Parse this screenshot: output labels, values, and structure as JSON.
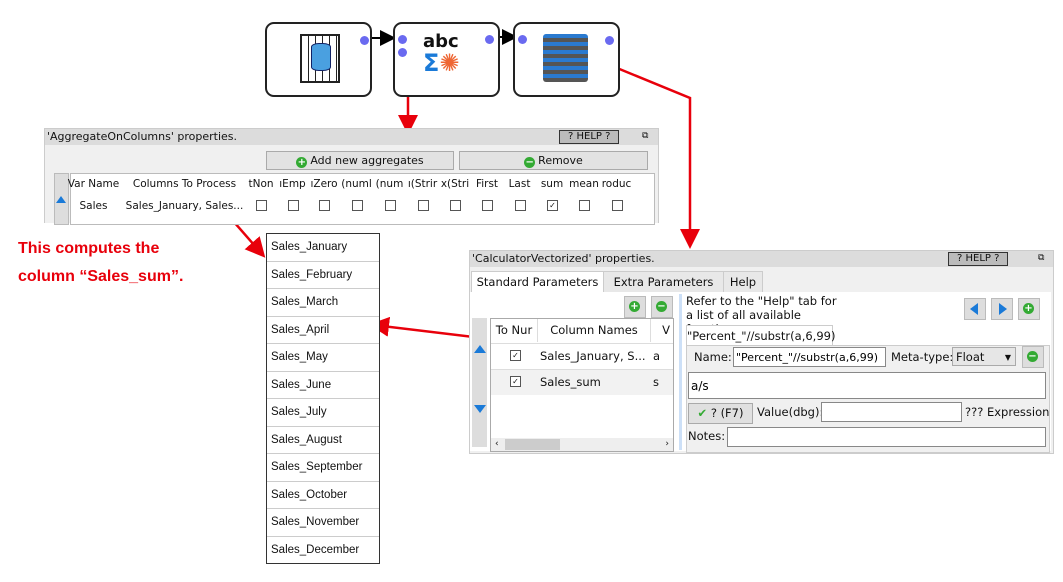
{
  "workflow": {
    "nodes": [
      {
        "name": "data-table-node"
      },
      {
        "name": "aggregate-on-columns-node"
      },
      {
        "name": "calculator-vectorized-node"
      }
    ]
  },
  "aggregate": {
    "title": "'AggregateOnColumns' properties.",
    "help": "? HELP ?",
    "add": "Add new aggregates",
    "remove": "Remove",
    "headers": [
      "Var Name",
      "Columns To Process",
      "tNon",
      "ıEmp",
      "ıZero",
      "(numl",
      "(num",
      "ı(Strir",
      "x(Stri",
      "First",
      "Last",
      "sum",
      "mean",
      "roduc"
    ],
    "row": {
      "var": "Sales",
      "cols": "Sales_January, Sales...",
      "checks": [
        false,
        false,
        false,
        false,
        false,
        false,
        false,
        false,
        false,
        true,
        false,
        false
      ]
    }
  },
  "annotation": {
    "line1": "This computes the",
    "line2": "column “Sales_sum”."
  },
  "months": [
    "Sales_January",
    "Sales_February",
    "Sales_March",
    "Sales_April",
    "Sales_May",
    "Sales_June",
    "Sales_July",
    "Sales_August",
    "Sales_September",
    "Sales_October",
    "Sales_November",
    "Sales_December"
  ],
  "calc": {
    "title": "'CalculatorVectorized' properties.",
    "help": "? HELP ?",
    "tabs": [
      "Standard Parameters",
      "Extra Parameters",
      "Help"
    ],
    "headers": [
      "To Nur",
      "Column Names",
      "V"
    ],
    "rows": [
      {
        "checked": true,
        "name": "Sales_January, S...",
        "var": "a"
      },
      {
        "checked": true,
        "name": "Sales_sum",
        "var": "s"
      }
    ],
    "info": "Refer to the \"Help\" tab for a list of all available functions.",
    "exprTab": "\"Percent_\"//substr(a,6,99)",
    "nameLabel": "Name:",
    "nameValue": "\"Percent_\"//substr(a,6,99)",
    "metaLabel": "Meta-type:",
    "metaValue": "Float",
    "expression": "a/s",
    "checkBtn": "? (F7)",
    "valueLabel": "Value(dbg):",
    "status": "??? Expression",
    "notesLabel": "Notes:"
  },
  "colors": {
    "annotation": "#e8000b",
    "port": "#6a6af0"
  }
}
